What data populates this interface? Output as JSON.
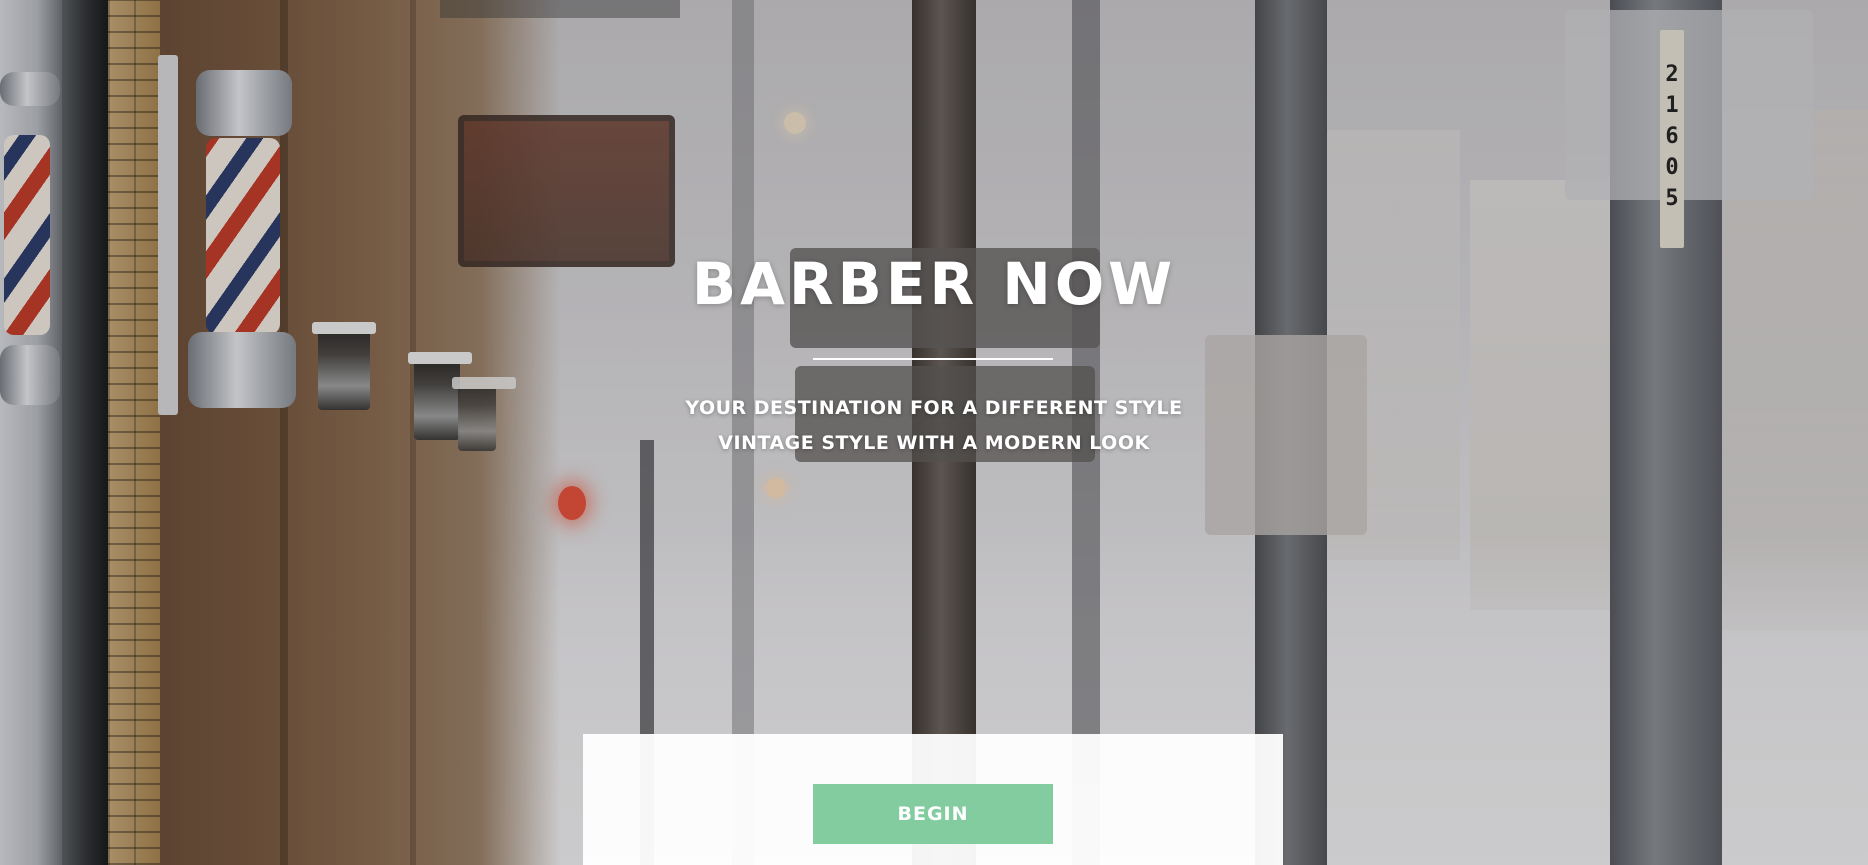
{
  "hero": {
    "title": "BARBER NOW",
    "subtitle_line1": "YOUR DESTINATION FOR A DIFFERENT STYLE",
    "subtitle_line2": "VINTAGE STYLE WITH A MODERN LOOK"
  },
  "cta": {
    "begin_label": "BEGIN"
  },
  "background": {
    "pole_number": "21605"
  },
  "colors": {
    "accent_button": "#83cca0",
    "text": "#ffffff",
    "panel": "#ffffff"
  }
}
